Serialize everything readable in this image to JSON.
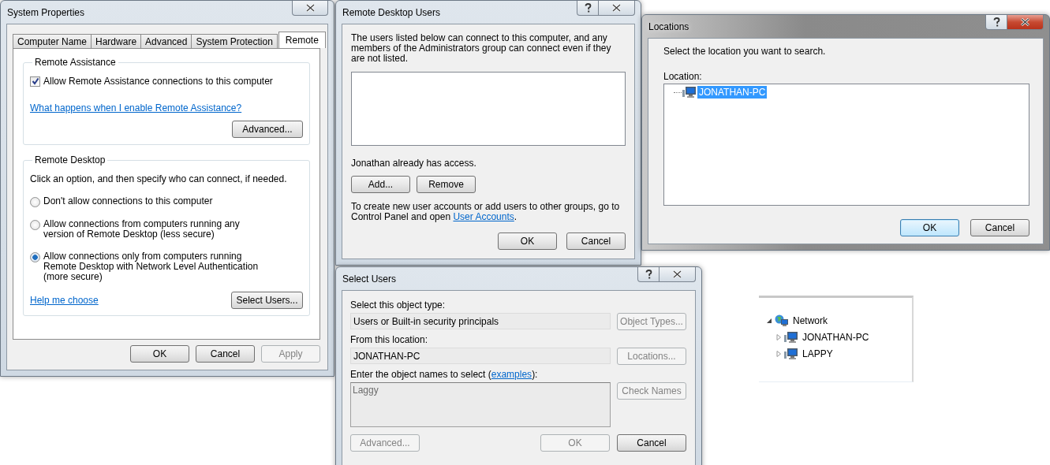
{
  "system_properties": {
    "title": "System Properties",
    "tabs": [
      {
        "label": "Computer Name",
        "selected": false
      },
      {
        "label": "Hardware",
        "selected": false
      },
      {
        "label": "Advanced",
        "selected": false
      },
      {
        "label": "System Protection",
        "selected": false
      },
      {
        "label": "Remote",
        "selected": true
      }
    ],
    "remote_assistance": {
      "heading": "Remote Assistance",
      "checkbox": {
        "label": "Allow Remote Assistance connections to this computer",
        "checked": true
      },
      "link": "What happens when I enable Remote Assistance?",
      "button": "Advanced..."
    },
    "remote_desktop": {
      "heading": "Remote Desktop",
      "intro": "Click an option, and then specify who can connect, if needed.",
      "options": [
        {
          "label": "Don't allow connections to this computer",
          "selected": false
        },
        {
          "label": "Allow connections from computers running any version of Remote Desktop (less secure)",
          "selected": false
        },
        {
          "label": "Allow connections only from computers running Remote Desktop with Network Level Authentication (more secure)",
          "selected": true
        }
      ],
      "link": "Help me choose",
      "button": "Select Users..."
    },
    "buttons": [
      {
        "label": "OK",
        "disabled": false
      },
      {
        "label": "Cancel",
        "disabled": false
      },
      {
        "label": "Apply",
        "disabled": true
      }
    ]
  },
  "remote_desktop_users": {
    "title": "Remote Desktop Users",
    "description": "The users listed below can connect to this computer, and any members of the Administrators group can connect even if they are not listed.",
    "access_note": "Jonathan already has access.",
    "buttons": [
      {
        "label": "Add...",
        "disabled": false
      },
      {
        "label": "Remove",
        "disabled": false
      }
    ],
    "footer": {
      "text": "To create new user accounts or add users to other groups, go to Control Panel and open ",
      "link": "User Accounts",
      "end": "."
    },
    "dialog_buttons": [
      {
        "label": "OK",
        "disabled": false
      },
      {
        "label": "Cancel",
        "disabled": false
      }
    ]
  },
  "locations": {
    "title": "Locations",
    "prompt": "Select the location you want to search.",
    "label": "Location:",
    "tree": [
      {
        "label": "JONATHAN-PC",
        "selected": true
      }
    ],
    "buttons": [
      {
        "label": "OK",
        "default": true
      },
      {
        "label": "Cancel",
        "default": false
      }
    ]
  },
  "select_users": {
    "title": "Select Users",
    "fields": [
      {
        "label": "Select this object type:",
        "value": "Users or Built-in security principals",
        "button": {
          "label": "Object Types...",
          "disabled": true
        }
      },
      {
        "label": "From this location:",
        "value": "JONATHAN-PC",
        "button": {
          "label": "Locations...",
          "disabled": true
        }
      }
    ],
    "names": {
      "label": "Enter the object names to select (",
      "link": "examples",
      "label_end": "):",
      "value": "Laggy",
      "button": {
        "label": "Check Names",
        "disabled": true
      }
    },
    "buttons": [
      {
        "label": "Advanced...",
        "disabled": true
      },
      {
        "label": "OK",
        "disabled": true
      },
      {
        "label": "Cancel",
        "disabled": false
      }
    ]
  },
  "network_tree": {
    "items": [
      {
        "label": "Network",
        "kind": "network",
        "expanded": true,
        "children": [
          {
            "label": "JONATHAN-PC",
            "kind": "computer",
            "expanded": false
          },
          {
            "label": "LAPPY",
            "kind": "computer",
            "expanded": false
          }
        ]
      }
    ]
  }
}
